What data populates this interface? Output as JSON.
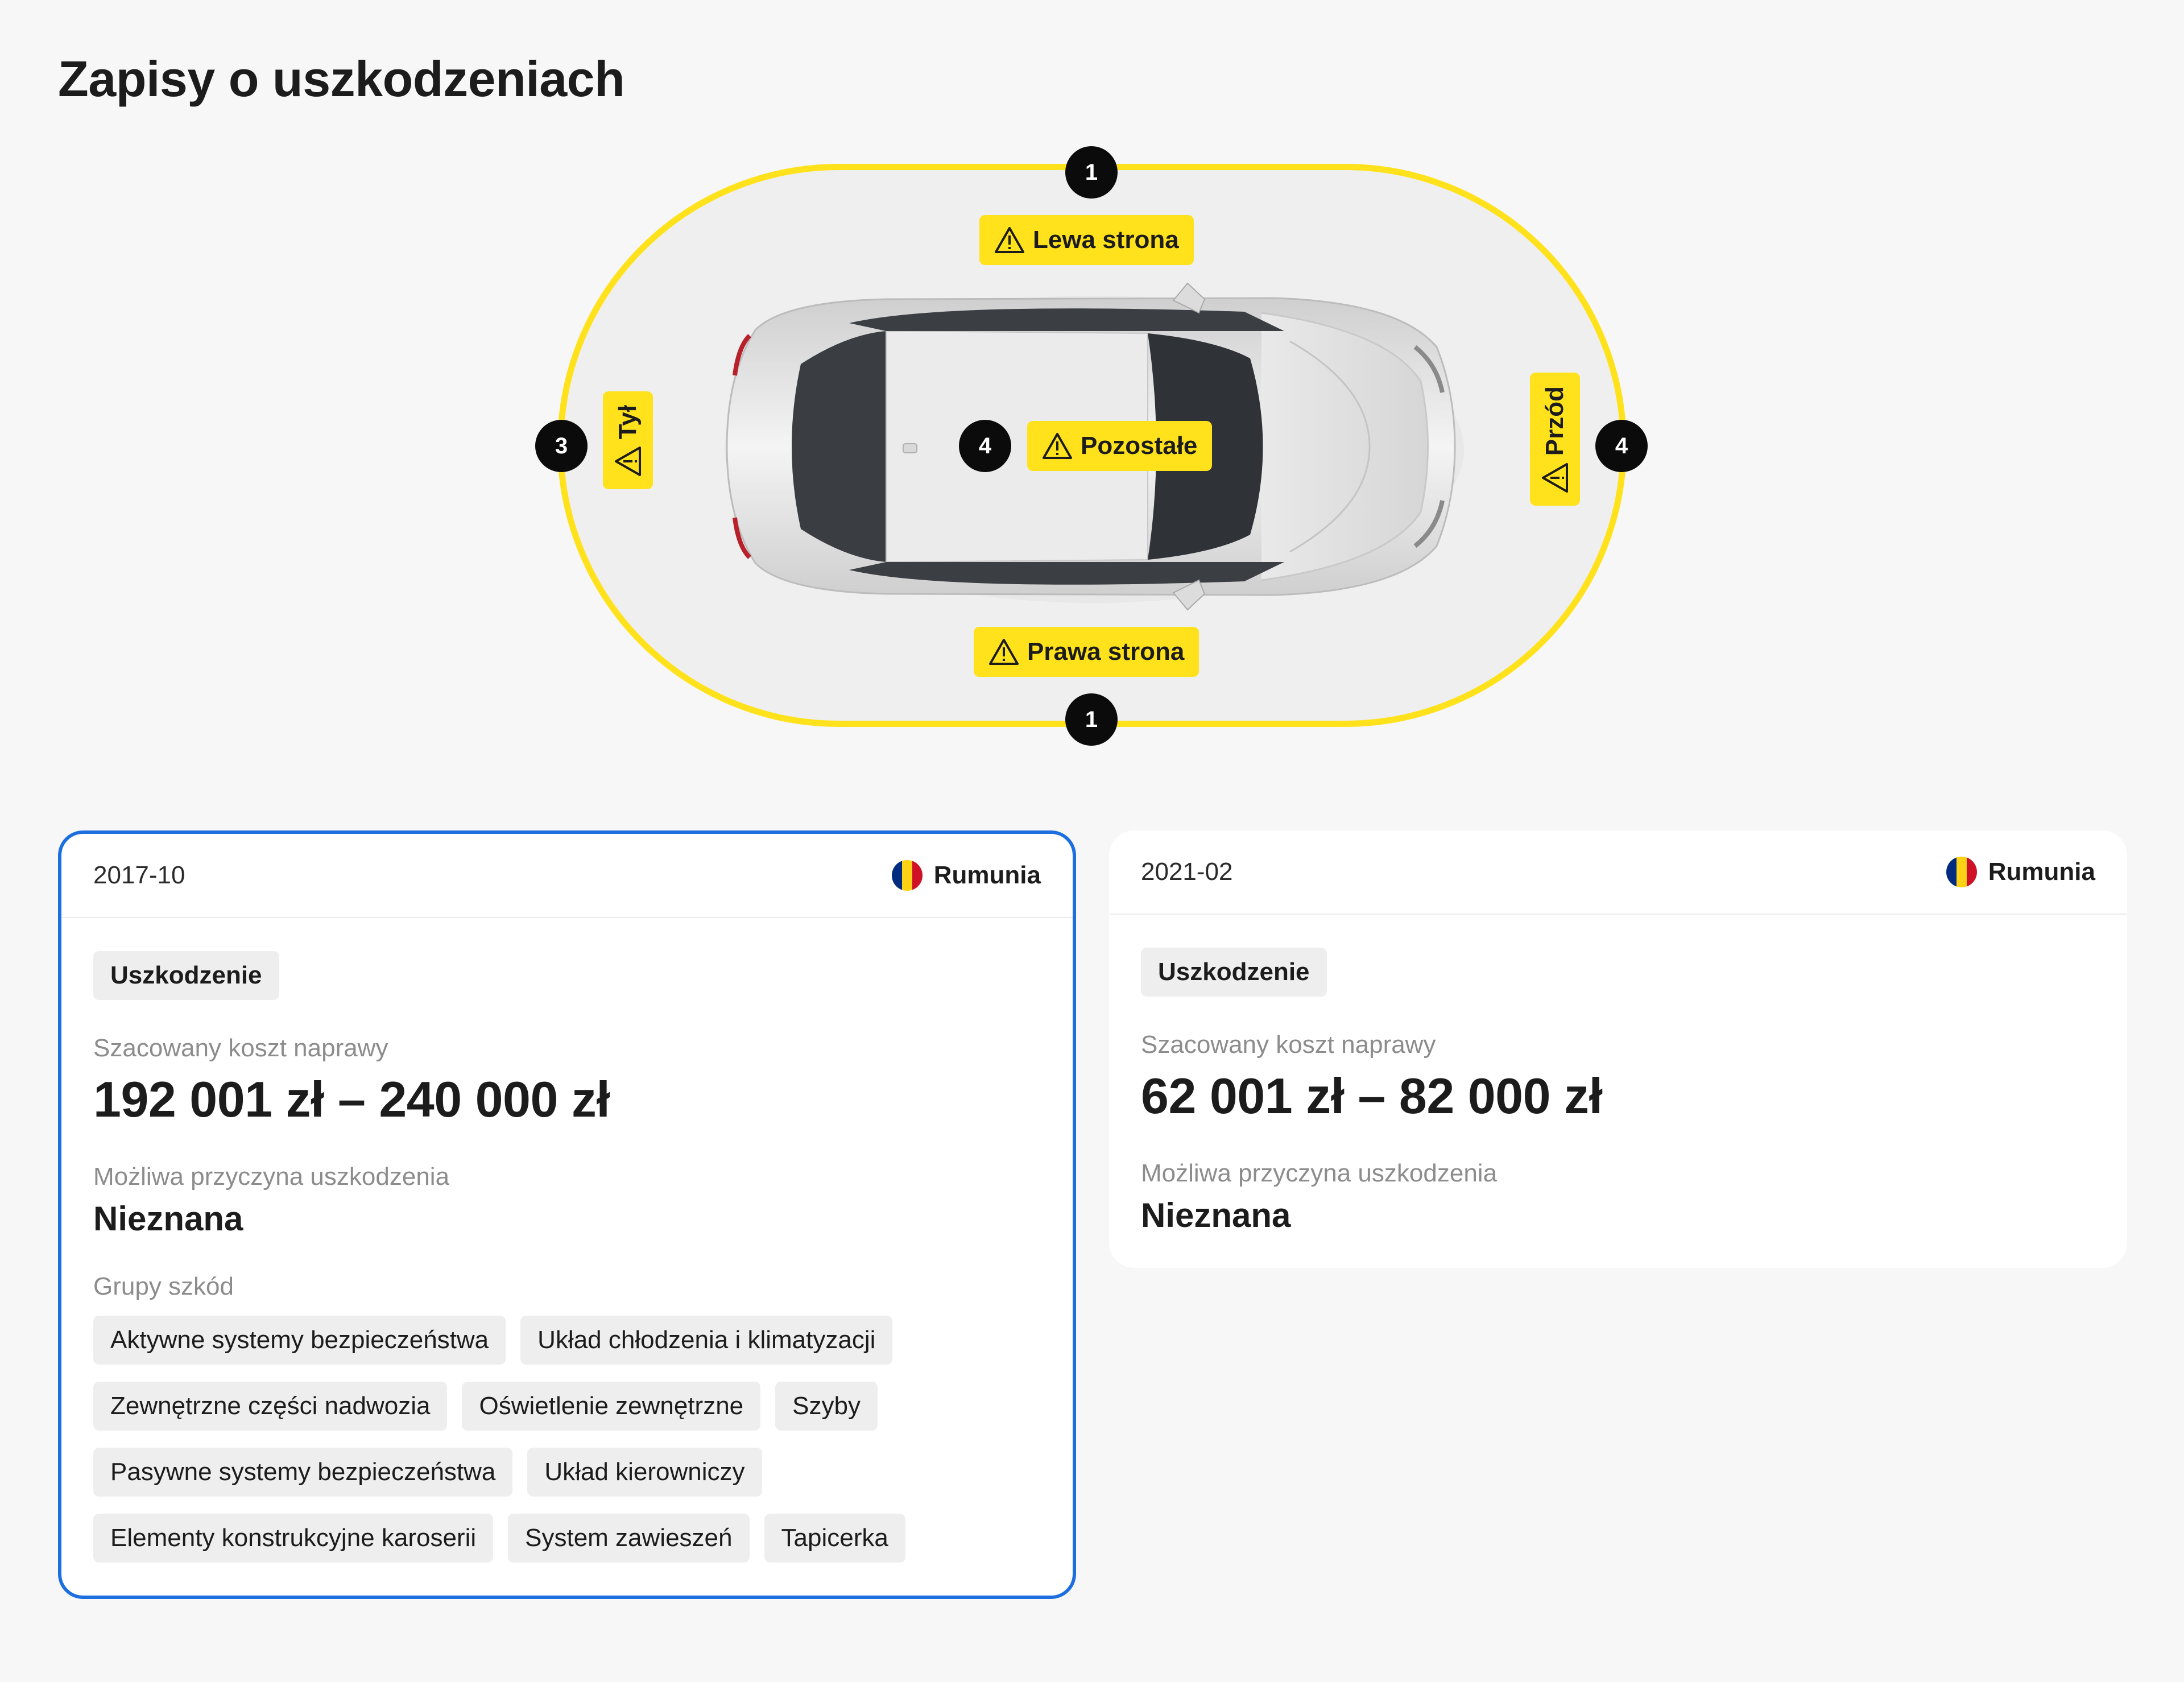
{
  "page": {
    "title": "Zapisy o uszkodzeniach"
  },
  "diagram": {
    "zones": {
      "left_side": {
        "label": "Lewa strona",
        "count": "1"
      },
      "right_side": {
        "label": "Prawa strona",
        "count": "1"
      },
      "rear": {
        "label": "Tył",
        "count": "3"
      },
      "front": {
        "label": "Przód",
        "count": "4"
      },
      "other": {
        "label": "Pozostałe",
        "count": "4"
      }
    },
    "colors": {
      "accent": "#ffe21c",
      "badge": "#0b0b0b"
    },
    "icon": "warning-triangle-icon"
  },
  "records": [
    {
      "date": "2017-10",
      "country": "Rumunia",
      "flag_colors": [
        "#002b7f",
        "#fcd116",
        "#ce1126"
      ],
      "type": "Uszkodzenie",
      "cost_label": "Szacowany koszt naprawy",
      "cost_value": "192 001 zł – 240 000 zł",
      "cause_label": "Możliwa przyczyna uszkodzenia",
      "cause_value": "Nieznana",
      "groups_label": "Grupy szkód",
      "groups": [
        "Aktywne systemy bezpieczeństwa",
        "Układ chłodzenia i klimatyzacji",
        "Zewnętrzne części nadwozia",
        "Oświetlenie zewnętrzne",
        "Szyby",
        "Pasywne systemy bezpieczeństwa",
        "Układ kierowniczy",
        "Elementy konstrukcyjne karoserii",
        "System zawieszeń",
        "Tapicerka"
      ],
      "selected": true
    },
    {
      "date": "2021-02",
      "country": "Rumunia",
      "flag_colors": [
        "#002b7f",
        "#fcd116",
        "#ce1126"
      ],
      "type": "Uszkodzenie",
      "cost_label": "Szacowany koszt naprawy",
      "cost_value": "62 001 zł – 82 000 zł",
      "cause_label": "Możliwa przyczyna uszkodzenia",
      "cause_value": "Nieznana",
      "selected": false
    }
  ],
  "selection_color": "#1d6fe0"
}
